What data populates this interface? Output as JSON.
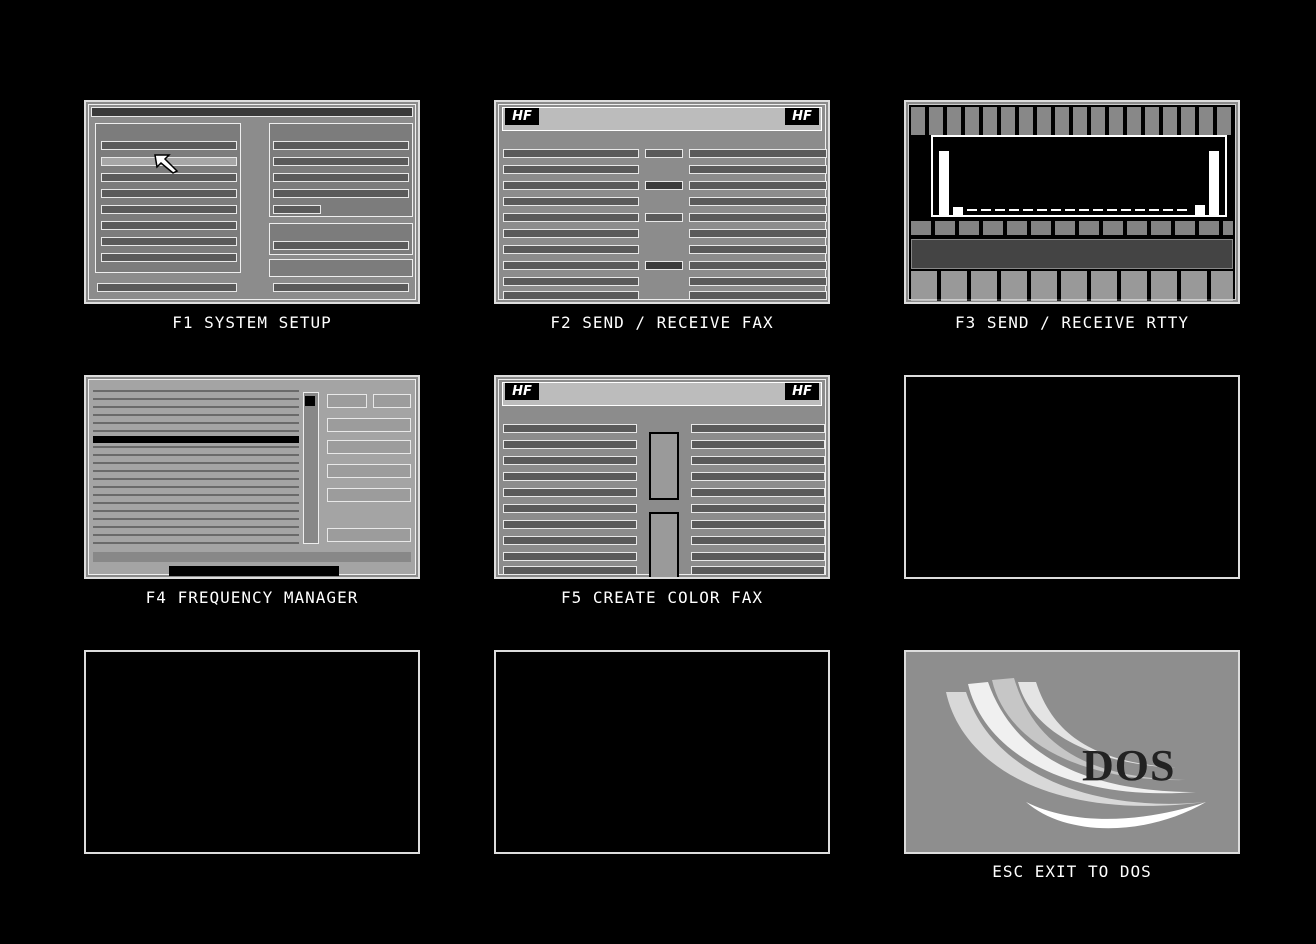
{
  "menu": {
    "items": [
      {
        "key": "F1",
        "label": "F1 SYSTEM SETUP"
      },
      {
        "key": "F2",
        "label": "F2 SEND / RECEIVE FAX"
      },
      {
        "key": "F3",
        "label": "F3 SEND / RECEIVE RTTY"
      },
      {
        "key": "F4",
        "label": "F4  FREQUENCY MANAGER"
      },
      {
        "key": "F5",
        "label": "F5 CREATE COLOR FAX"
      },
      {
        "key": "ESC",
        "label": "ESC  EXIT TO DOS"
      }
    ],
    "dos_logo_text": "DOS"
  }
}
